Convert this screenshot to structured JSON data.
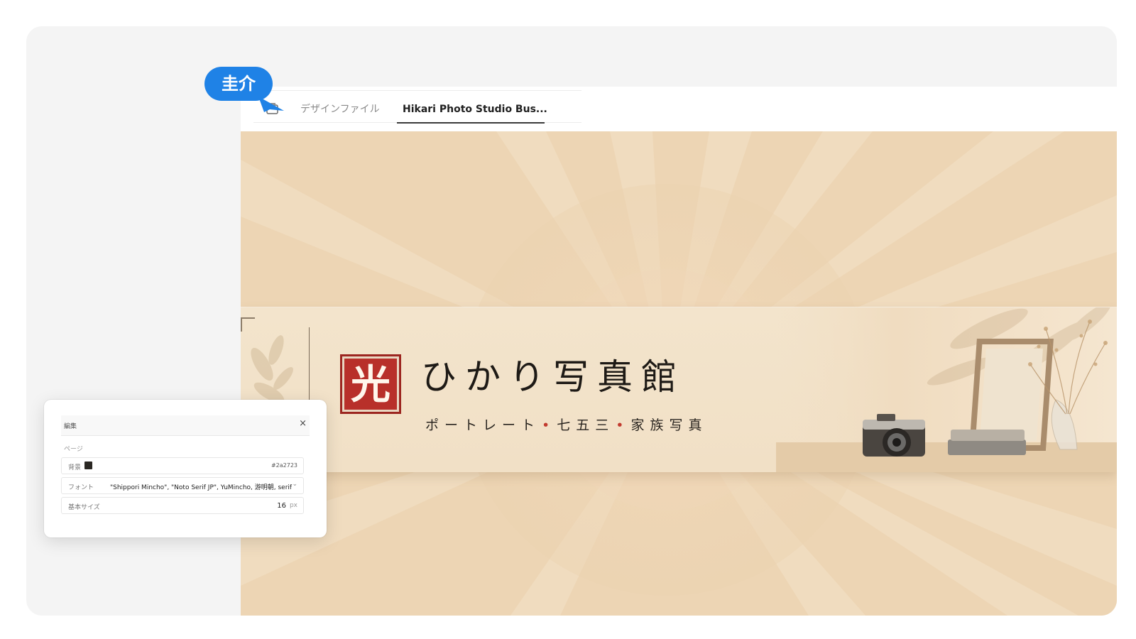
{
  "editor": {
    "tabs": [
      {
        "label": "デザインファイル",
        "active": false
      },
      {
        "label": "Hikari Photo Studio Bus...",
        "active": true
      }
    ]
  },
  "banner": {
    "logo_mark": "光",
    "brand_name": "ひかり写真館",
    "tagline_parts": [
      "ポートレート",
      "七五三",
      "家族写真"
    ],
    "tagline_separator": "•",
    "accent_color": "#c23a2f",
    "seal_color": "#b8302a"
  },
  "edit_panel": {
    "title": "編集",
    "close_label": "×",
    "section": "ページ",
    "background": {
      "label": "背景",
      "value": "#2a2723"
    },
    "font": {
      "label": "フォント",
      "value": "\"Shippori Mincho\", \"Noto Serif JP\", YuMincho, 游明朝, serif"
    },
    "base_size": {
      "label": "基本サイズ",
      "value": "16",
      "unit": "px"
    }
  },
  "collaborator": {
    "name": "圭介",
    "color": "#1f82e6"
  }
}
